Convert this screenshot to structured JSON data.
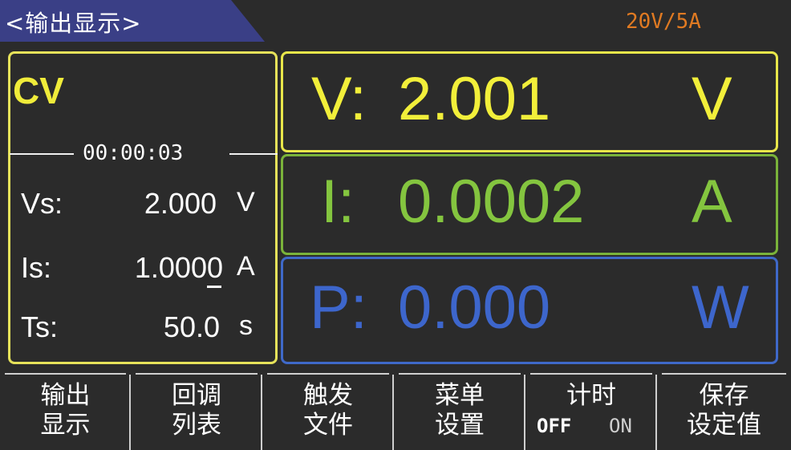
{
  "header": {
    "title": "<输出显示>",
    "range": "20V/5A"
  },
  "status": {
    "mode": "CV",
    "timer": "00:00:03"
  },
  "settings": {
    "vs": {
      "label": "Vs:",
      "value": "2.000",
      "unit": "V"
    },
    "is": {
      "label": "Is:",
      "value": "1.0000",
      "unit": "A"
    },
    "ts": {
      "label": "Ts:",
      "value": "50.0",
      "unit": "s"
    }
  },
  "measurements": {
    "voltage": {
      "label": "V:",
      "value": "2.001",
      "unit": "V",
      "color": "#f2ef3a"
    },
    "current": {
      "label": "I:",
      "value": "0.0002",
      "unit": "A",
      "color": "#84c53f"
    },
    "power": {
      "label": "P:",
      "value": "0.000",
      "unit": "W",
      "color": "#3d66cc"
    }
  },
  "softkeys": [
    {
      "line1": "输出",
      "line2": "显示"
    },
    {
      "line1": "回调",
      "line2": "列表"
    },
    {
      "line1": "触发",
      "line2": "文件"
    },
    {
      "line1": "菜单",
      "line2": "设置"
    },
    {
      "line1": "计时",
      "off": "OFF",
      "on": "ON"
    },
    {
      "line1": "保存",
      "line2": "设定值"
    }
  ]
}
